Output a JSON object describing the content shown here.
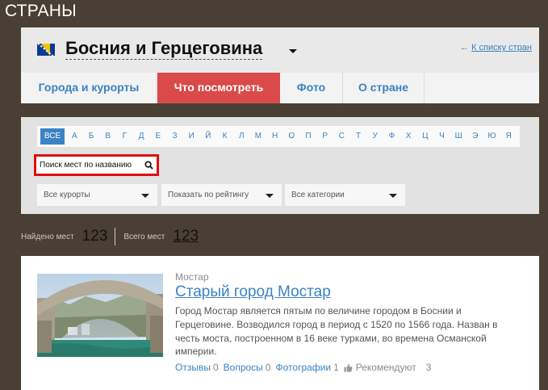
{
  "page_title": "СТРАНЫ",
  "country": {
    "name": "Босния и Герцеговина",
    "back_link": "К списку стран",
    "back_arrow": "←"
  },
  "tabs": [
    {
      "label": "Города и курорты",
      "active": false
    },
    {
      "label": "Что посмотреть",
      "active": true
    },
    {
      "label": "Фото",
      "active": false
    },
    {
      "label": "О стране",
      "active": false
    }
  ],
  "alphabet": {
    "all_label": "ВСЕ",
    "letters": [
      "А",
      "Б",
      "В",
      "Г",
      "Д",
      "Е",
      "З",
      "И",
      "Й",
      "К",
      "Л",
      "М",
      "Н",
      "О",
      "П",
      "Р",
      "С",
      "Т",
      "У",
      "Ф",
      "Х",
      "Ц",
      "Ч",
      "Ш",
      "Э",
      "Ю",
      "Я"
    ]
  },
  "search": {
    "placeholder": "Поиск мест по названию"
  },
  "filters": {
    "resort": "Все курорты",
    "rating": "Показать по рейтингу",
    "category": "Все категории"
  },
  "counts": {
    "found_label": "Найдено мест",
    "found_value": "123",
    "total_label": "Всего мест",
    "total_value": "123"
  },
  "place": {
    "region": "Мостар",
    "title": "Старый город Мостар",
    "description": "Город Мостар является пятым по величине городом в Боснии и Герцеговине. Возводился город в период с 1520 по 1566 года. Назван в честь моста, построенном в 16 веке турками, во времена Османской империи.",
    "reviews_label": "Отзывы",
    "reviews_count": "0",
    "questions_label": "Вопросы",
    "questions_count": "0",
    "photos_label": "Фотографии",
    "photos_count": "1",
    "recommend_label": "Рекомендуют",
    "recommend_count": "3"
  },
  "colors": {
    "background": "#4a3f34",
    "accent_blue": "#3a83c4",
    "active_tab": "#da4a4a",
    "search_highlight": "#e01010"
  }
}
